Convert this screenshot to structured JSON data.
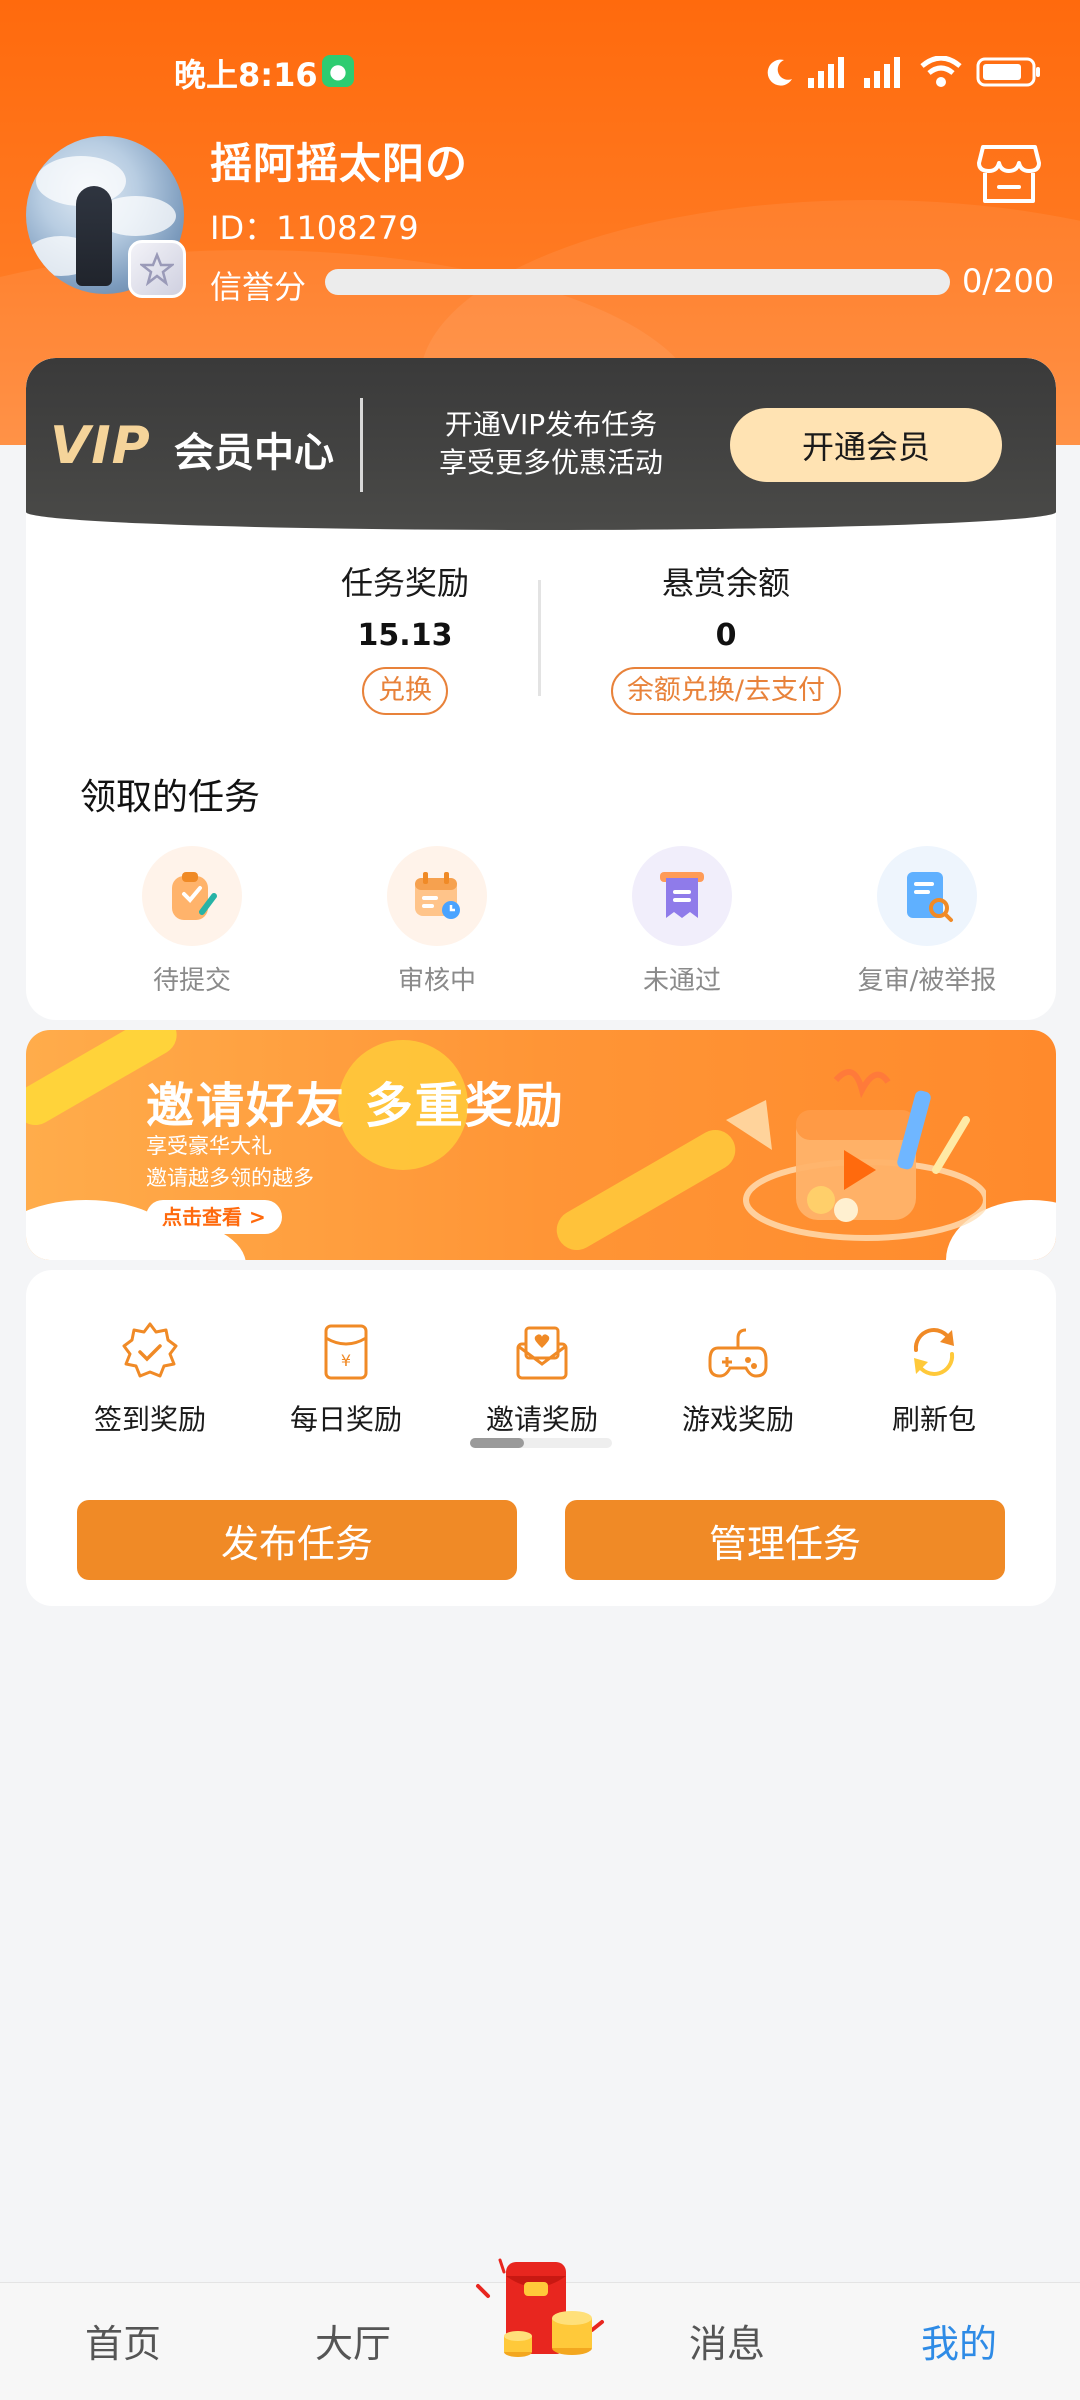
{
  "status_bar": {
    "time": "晚上8:16",
    "app_indicator_icon": "app-notification-icon",
    "icons": [
      "moon-icon",
      "signal-icon",
      "signal-icon",
      "wifi-icon",
      "battery-icon"
    ]
  },
  "profile": {
    "username": "摇阿摇太阳の",
    "user_id": "ID：1108279",
    "credit_label": "信誉分",
    "credit_value": "0/200",
    "credit_fraction": 0
  },
  "vip": {
    "logo_text": "VIP",
    "center_text": "会员中心",
    "promo_line1": "开通VIP发布任务",
    "promo_line2": "享受更多优惠活动",
    "open_button": "开通会员"
  },
  "stats": {
    "task_reward_label": "任务奖励",
    "task_reward_value": "15.13",
    "task_reward_action": "兑换",
    "bounty_label": "悬赏余额",
    "bounty_value": "0",
    "bounty_action": "余额兑换/去支付"
  },
  "received_tasks": {
    "title": "领取的任务",
    "items": [
      {
        "label": "待提交",
        "icon": "clipboard-pen-icon"
      },
      {
        "label": "审核中",
        "icon": "calendar-clock-icon"
      },
      {
        "label": "未通过",
        "icon": "receipt-icon"
      },
      {
        "label": "复审/被举报",
        "icon": "document-search-icon"
      }
    ]
  },
  "banner": {
    "title": "邀请好友 多重奖励",
    "sub1": "享受豪华大礼",
    "sub2": "邀请越多领的越多",
    "cta": "点击查看 >"
  },
  "rewards": {
    "items": [
      {
        "label": "签到奖励",
        "icon": "badge-check-icon"
      },
      {
        "label": "每日奖励",
        "icon": "yen-envelope-icon"
      },
      {
        "label": "邀请奖励",
        "icon": "invite-letter-icon"
      },
      {
        "label": "游戏奖励",
        "icon": "gamepad-icon"
      },
      {
        "label": "刷新包",
        "icon": "refresh-icon"
      }
    ],
    "publish_button": "发布任务",
    "manage_button": "管理任务"
  },
  "nav": {
    "items": [
      "首页",
      "大厅",
      "消息",
      "我的"
    ],
    "active": "我的"
  },
  "colors": {
    "header_orange": "#ff6a0d",
    "accent_orange": "#f08a26",
    "vip_gold": "#ffe3b3",
    "nav_active": "#2e8be6"
  }
}
